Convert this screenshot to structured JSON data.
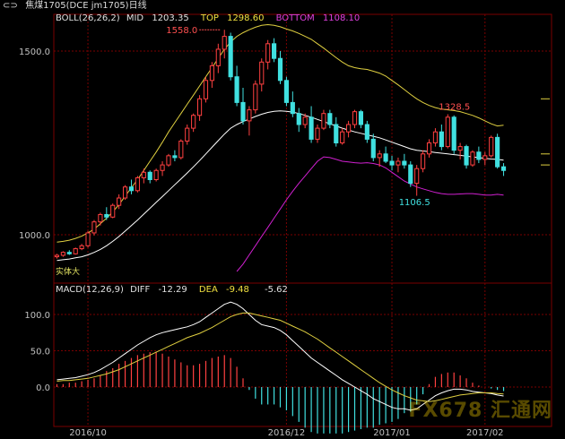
{
  "title": {
    "icon": "link-icon",
    "text": "焦煤1705(DCE jm1705)日线"
  },
  "boll_info": {
    "name": "BOLL(26,26,2)",
    "mid_label": "MID",
    "mid_value": "1203.35",
    "top_label": "TOP",
    "top_value": "1298.60",
    "bottom_label": "BOTTOM",
    "bottom_value": "1108.10"
  },
  "macd_info": {
    "name": "MACD(12,26,9)",
    "diff_label": "DIFF",
    "diff_value": "-12.29",
    "dea_label": "DEA",
    "dea_value": "-9.48",
    "macd_value": "-5.62"
  },
  "colors": {
    "up": "#ff4040",
    "down": "#40e0e0",
    "mid": "#ffffff",
    "top": "#e0d040",
    "bottom": "#d020d0",
    "diff": "#ffffff",
    "dea": "#e0d040",
    "grid": "#7a0000",
    "axis_text": "#c0c0c0",
    "annotation_red": "#ff5050",
    "annotation_cyan": "#40e0e0"
  },
  "watermark": "FX678 汇通网",
  "chart_data": [
    {
      "type": "candlestick",
      "title": "BOLL(26,26,2)",
      "y_ticks": [
        "1500.0",
        "1000.0"
      ],
      "ylim": [
        900,
        1600
      ],
      "x_labels": [
        "2016/10",
        "2016/12",
        "2017/01",
        "2017/02"
      ],
      "annotations": {
        "high": "1558.0",
        "peak2": "1328.5",
        "low": "1106.5",
        "start_label": "实体大"
      },
      "candles": [
        [
          940,
          948,
          935,
          944
        ],
        [
          944,
          955,
          940,
          952
        ],
        [
          952,
          958,
          945,
          948
        ],
        [
          948,
          965,
          946,
          962
        ],
        [
          962,
          975,
          958,
          970
        ],
        [
          970,
          1010,
          965,
          1005
        ],
        [
          1005,
          1040,
          998,
          1035
        ],
        [
          1035,
          1060,
          1025,
          1055
        ],
        [
          1055,
          1075,
          1040,
          1048
        ],
        [
          1048,
          1085,
          1045,
          1080
        ],
        [
          1080,
          1110,
          1070,
          1100
        ],
        [
          1100,
          1135,
          1095,
          1130
        ],
        [
          1130,
          1150,
          1110,
          1120
        ],
        [
          1120,
          1160,
          1115,
          1155
        ],
        [
          1155,
          1180,
          1140,
          1170
        ],
        [
          1170,
          1175,
          1140,
          1150
        ],
        [
          1150,
          1180,
          1145,
          1175
        ],
        [
          1175,
          1200,
          1160,
          1190
        ],
        [
          1190,
          1220,
          1185,
          1215
        ],
        [
          1215,
          1230,
          1200,
          1210
        ],
        [
          1210,
          1260,
          1205,
          1255
        ],
        [
          1255,
          1300,
          1245,
          1290
        ],
        [
          1290,
          1330,
          1280,
          1325
        ],
        [
          1325,
          1380,
          1310,
          1370
        ],
        [
          1370,
          1430,
          1360,
          1420
        ],
        [
          1420,
          1470,
          1400,
          1460
        ],
        [
          1460,
          1520,
          1440,
          1505
        ],
        [
          1505,
          1558,
          1480,
          1540
        ],
        [
          1540,
          1550,
          1420,
          1430
        ],
        [
          1430,
          1460,
          1350,
          1360
        ],
        [
          1360,
          1400,
          1300,
          1310
        ],
        [
          1310,
          1350,
          1270,
          1340
        ],
        [
          1340,
          1420,
          1330,
          1410
        ],
        [
          1410,
          1480,
          1390,
          1470
        ],
        [
          1470,
          1530,
          1450,
          1520
        ],
        [
          1520,
          1535,
          1470,
          1480
        ],
        [
          1480,
          1500,
          1410,
          1420
        ],
        [
          1420,
          1430,
          1350,
          1360
        ],
        [
          1360,
          1390,
          1320,
          1330
        ],
        [
          1330,
          1345,
          1280,
          1300
        ],
        [
          1300,
          1330,
          1290,
          1320
        ],
        [
          1320,
          1350,
          1250,
          1260
        ],
        [
          1260,
          1300,
          1250,
          1290
        ],
        [
          1290,
          1340,
          1285,
          1330
        ],
        [
          1330,
          1340,
          1290,
          1300
        ],
        [
          1300,
          1320,
          1240,
          1250
        ],
        [
          1250,
          1290,
          1245,
          1280
        ],
        [
          1280,
          1310,
          1265,
          1300
        ],
        [
          1300,
          1340,
          1290,
          1335
        ],
        [
          1335,
          1340,
          1290,
          1300
        ],
        [
          1300,
          1310,
          1250,
          1260
        ],
        [
          1260,
          1275,
          1200,
          1210
        ],
        [
          1210,
          1230,
          1185,
          1220
        ],
        [
          1220,
          1240,
          1195,
          1200
        ],
        [
          1200,
          1215,
          1175,
          1190
        ],
        [
          1190,
          1210,
          1170,
          1200
        ],
        [
          1200,
          1220,
          1180,
          1190
        ],
        [
          1190,
          1200,
          1130,
          1140
        ],
        [
          1140,
          1190,
          1106,
          1180
        ],
        [
          1180,
          1230,
          1170,
          1220
        ],
        [
          1220,
          1260,
          1210,
          1250
        ],
        [
          1250,
          1290,
          1240,
          1280
        ],
        [
          1280,
          1300,
          1230,
          1240
        ],
        [
          1240,
          1328,
          1235,
          1320
        ],
        [
          1320,
          1325,
          1220,
          1230
        ],
        [
          1230,
          1250,
          1205,
          1240
        ],
        [
          1240,
          1245,
          1180,
          1190
        ],
        [
          1190,
          1230,
          1185,
          1225
        ],
        [
          1225,
          1240,
          1195,
          1205
        ],
        [
          1205,
          1225,
          1190,
          1215
        ],
        [
          1215,
          1270,
          1210,
          1265
        ],
        [
          1265,
          1275,
          1180,
          1185
        ],
        [
          1185,
          1195,
          1160,
          1175
        ]
      ],
      "series": [
        {
          "name": "TOP",
          "values": [
            980,
            982,
            985,
            990,
            996,
            1005,
            1015,
            1030,
            1045,
            1062,
            1082,
            1105,
            1128,
            1150,
            1175,
            1200,
            1225,
            1252,
            1280,
            1305,
            1330,
            1355,
            1380,
            1405,
            1430,
            1455,
            1480,
            1505,
            1525,
            1540,
            1550,
            1558,
            1565,
            1570,
            1572,
            1570,
            1566,
            1560,
            1555,
            1548,
            1540,
            1532,
            1520,
            1508,
            1495,
            1482,
            1470,
            1460,
            1455,
            1452,
            1450,
            1445,
            1440,
            1432,
            1420,
            1408,
            1395,
            1382,
            1370,
            1360,
            1352,
            1346,
            1342,
            1340,
            1338,
            1335,
            1330,
            1325,
            1318,
            1310,
            1302,
            1296,
            1298
          ]
        },
        {
          "name": "MID",
          "values": [
            930,
            932,
            934,
            937,
            940,
            945,
            952,
            960,
            970,
            982,
            995,
            1010,
            1025,
            1040,
            1056,
            1072,
            1088,
            1104,
            1120,
            1136,
            1152,
            1168,
            1185,
            1202,
            1220,
            1238,
            1256,
            1274,
            1290,
            1300,
            1308,
            1315,
            1322,
            1328,
            1333,
            1336,
            1337,
            1336,
            1334,
            1330,
            1325,
            1320,
            1314,
            1308,
            1302,
            1296,
            1290,
            1285,
            1280,
            1276,
            1272,
            1268,
            1264,
            1258,
            1252,
            1246,
            1240,
            1234,
            1230,
            1228,
            1226,
            1224,
            1222,
            1220,
            1218,
            1216,
            1214,
            1212,
            1210,
            1208,
            1206,
            1205,
            1203
          ]
        },
        {
          "name": "BOTTOM",
          "values": [
            null,
            null,
            null,
            null,
            null,
            null,
            null,
            null,
            null,
            null,
            null,
            null,
            null,
            null,
            null,
            null,
            null,
            null,
            null,
            null,
            null,
            null,
            null,
            null,
            null,
            null,
            null,
            null,
            null,
            900,
            920,
            945,
            970,
            995,
            1020,
            1045,
            1070,
            1095,
            1118,
            1140,
            1160,
            1180,
            1200,
            1212,
            1210,
            1205,
            1200,
            1198,
            1196,
            1195,
            1196,
            1194,
            1190,
            1182,
            1170,
            1158,
            1146,
            1138,
            1130,
            1125,
            1120,
            1115,
            1112,
            1110,
            1110,
            1111,
            1112,
            1112,
            1110,
            1108,
            1108,
            1110,
            1108
          ]
        }
      ]
    },
    {
      "type": "bar",
      "title": "MACD(12,26,9)",
      "y_ticks": [
        "100.0",
        "50.0",
        "0.0"
      ],
      "ylim": [
        -50,
        125
      ],
      "series": [
        {
          "name": "DIFF",
          "values": [
            10,
            11,
            12,
            13,
            15,
            17,
            20,
            24,
            29,
            34,
            40,
            46,
            52,
            58,
            63,
            68,
            72,
            75,
            77,
            79,
            81,
            83,
            86,
            90,
            96,
            102,
            108,
            114,
            117,
            114,
            108,
            100,
            92,
            86,
            84,
            82,
            78,
            72,
            64,
            56,
            48,
            40,
            34,
            28,
            22,
            16,
            10,
            5,
            0,
            -5,
            -10,
            -16,
            -20,
            -24,
            -28,
            -30,
            -30,
            -32,
            -30,
            -24,
            -18,
            -12,
            -8,
            -5,
            -3,
            -3,
            -4,
            -6,
            -7,
            -8,
            -9,
            -11,
            -12.29
          ]
        },
        {
          "name": "DEA",
          "values": [
            8,
            9,
            9,
            10,
            11,
            12,
            14,
            16,
            18,
            21,
            24,
            28,
            32,
            36,
            40,
            44,
            48,
            52,
            56,
            60,
            64,
            68,
            71,
            74,
            78,
            82,
            87,
            92,
            97,
            100,
            102,
            102,
            100,
            98,
            96,
            94,
            92,
            88,
            84,
            80,
            76,
            71,
            66,
            60,
            54,
            48,
            42,
            36,
            30,
            24,
            18,
            12,
            6,
            1,
            -4,
            -8,
            -12,
            -15,
            -18,
            -19,
            -20,
            -19,
            -17,
            -15,
            -13,
            -11,
            -10,
            -9,
            -8,
            -8,
            -8,
            -9,
            -9.48
          ]
        },
        {
          "name": "MACD",
          "values": [
            4,
            4,
            6,
            6,
            8,
            10,
            12,
            16,
            22,
            26,
            32,
            36,
            40,
            44,
            46,
            48,
            48,
            46,
            42,
            38,
            34,
            30,
            30,
            32,
            36,
            40,
            42,
            44,
            40,
            28,
            12,
            -4,
            -16,
            -24,
            -24,
            -24,
            -28,
            -32,
            -40,
            -48,
            -56,
            -62,
            -64,
            -64,
            -64,
            -64,
            -64,
            -62,
            -60,
            -58,
            -56,
            -56,
            -52,
            -50,
            -48,
            -44,
            -36,
            -34,
            -24,
            -10,
            4,
            14,
            18,
            20,
            20,
            16,
            12,
            6,
            2,
            0,
            -2,
            -4,
            -5.62
          ]
        }
      ]
    }
  ]
}
